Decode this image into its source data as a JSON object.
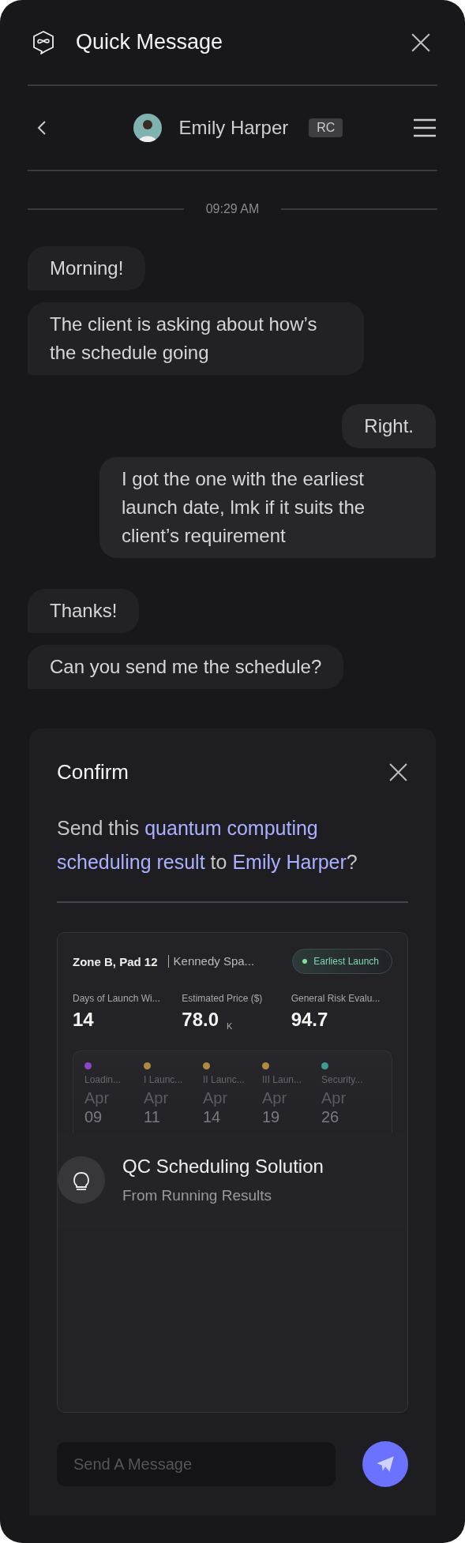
{
  "window": {
    "title": "Quick Message"
  },
  "contact": {
    "name": "Emily Harper",
    "badge": "RC"
  },
  "timestamp": "09:29 AM",
  "messages": [
    {
      "text": "Morning!",
      "outgoing": false
    },
    {
      "text": "The client is asking about how’s the schedule going",
      "outgoing": false
    },
    {
      "text": "Right.",
      "outgoing": true
    },
    {
      "text": "I got the one with the earliest launch date, lmk if it suits the client’s requirement",
      "outgoing": true
    },
    {
      "text": "Thanks!",
      "outgoing": false
    },
    {
      "text": "Can you send me the schedule?",
      "outgoing": false
    }
  ],
  "confirm": {
    "title": "Confirm",
    "highlights": [
      {
        "text": "Send this ",
        "highlight": false
      },
      {
        "text": "quantum computing scheduling result",
        "highlight": true
      },
      {
        "text": " to ",
        "highlight": false
      },
      {
        "text": "Emily Harper",
        "highlight": true
      },
      {
        "text": "?",
        "highlight": false
      }
    ]
  },
  "result_card": {
    "zone": "Zone B, Pad 12",
    "site": "Kennedy Spa...",
    "tag": "Earliest Launch",
    "stats": [
      {
        "label": "Days of Launch Wi...",
        "value": "14"
      },
      {
        "label": "Estimated Price ($)",
        "value": "78.0",
        "unit": "K"
      },
      {
        "label": "General Risk Evalu...",
        "value": "94.7"
      }
    ],
    "timeline": [
      {
        "label": "Loadin...",
        "month": "Apr",
        "day": "09",
        "color": "#8e44c8"
      },
      {
        "label": "I Launc...",
        "month": "Apr",
        "day": "11",
        "color": "#b08a3e"
      },
      {
        "label": "II Launc...",
        "month": "Apr",
        "day": "14",
        "color": "#b08a3e"
      },
      {
        "label": "III Laun...",
        "month": "Apr",
        "day": "19",
        "color": "#b08a3e"
      },
      {
        "label": "Security...",
        "month": "Apr",
        "day": "26",
        "color": "#3f9a92"
      }
    ],
    "solution": {
      "title": "QC Scheduling Solution",
      "subtitle": "From Running Results"
    }
  },
  "composer": {
    "placeholder": "Send A Message"
  }
}
